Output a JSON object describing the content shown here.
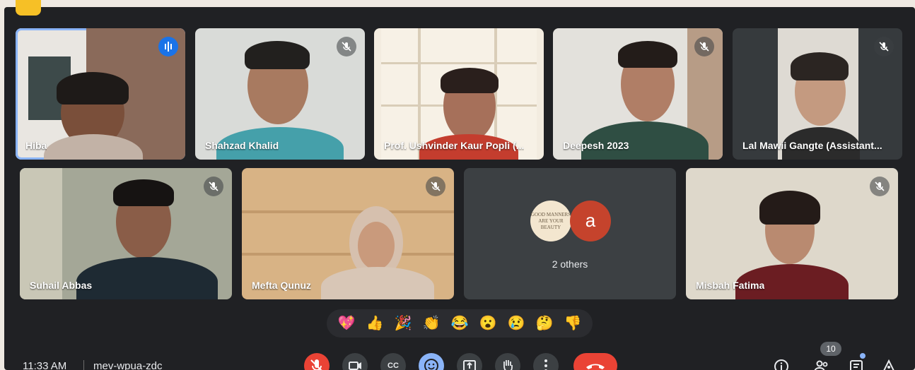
{
  "meeting": {
    "time": "11:33 AM",
    "code": "mev-wpua-zdc",
    "participant_count": "10"
  },
  "tiles": [
    {
      "name": "Hiba",
      "muted": false,
      "speaking": true
    },
    {
      "name": "Shahzad Khalid",
      "muted": true
    },
    {
      "name": "Prof. Ushvinder Kaur Popli (...",
      "muted": false
    },
    {
      "name": "Deepesh 2023",
      "muted": true
    },
    {
      "name": "Lal Mawii Gangte (Assistant...",
      "muted": true
    },
    {
      "name": "Suhail Abbas",
      "muted": true
    },
    {
      "name": "Mefta Qunuz",
      "muted": true
    },
    {
      "name": "Misbah Fatima",
      "muted": true
    }
  ],
  "others_tile": {
    "label": "2 others",
    "avatar_letter": "a",
    "quote_text": "GOOD MANNERS ARE YOUR BEAUTY"
  },
  "reactions": [
    "💖",
    "👍",
    "🎉",
    "👏",
    "😂",
    "😮",
    "😢",
    "🤔",
    "👎"
  ],
  "controls": {
    "mic_icon": "mic-off-icon",
    "camera_icon": "camera-icon",
    "captions_label": "CC",
    "emoji_icon": "emoji-icon",
    "present_icon": "present-icon",
    "hand_icon": "raise-hand-icon",
    "more_icon": "more-icon",
    "end_icon": "end-call-icon"
  },
  "colors": {
    "background": "#202124",
    "accent": "#8ab4f8",
    "end_call": "#ea4335"
  }
}
